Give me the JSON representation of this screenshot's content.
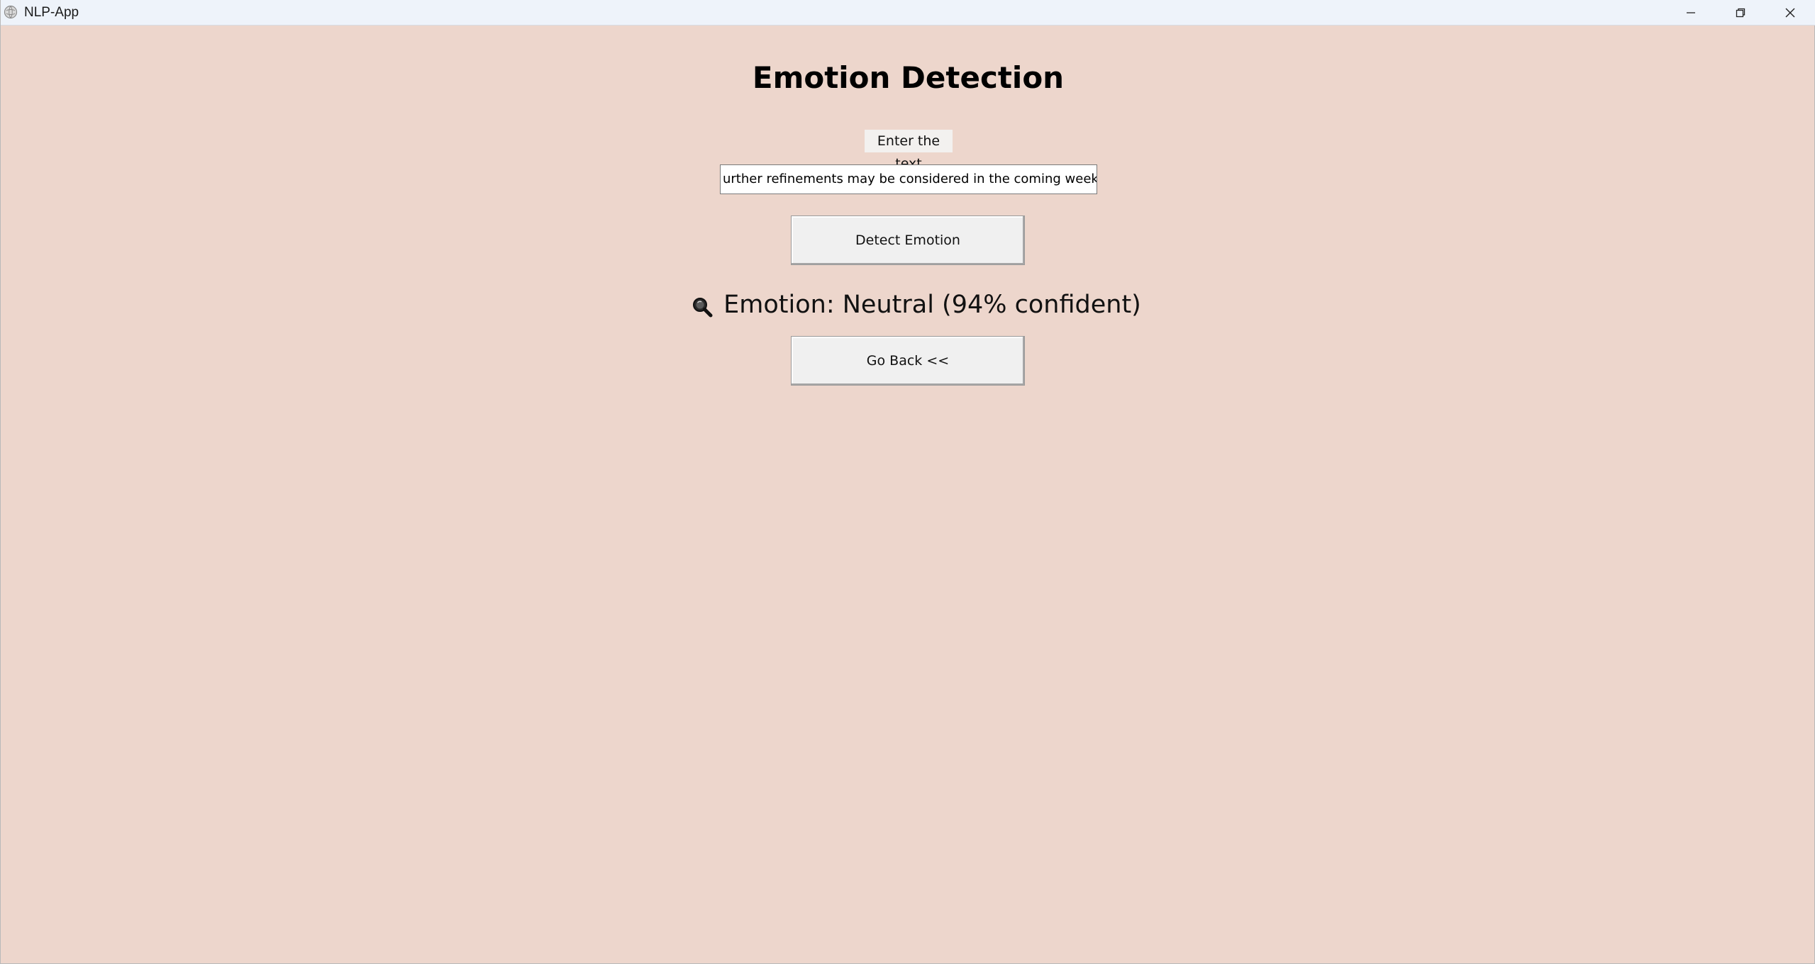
{
  "window": {
    "title": "NLP-App",
    "controls": {
      "minimize": "minimize-icon",
      "maximize": "restore-icon",
      "close": "close-icon"
    }
  },
  "page": {
    "heading": "Emotion Detection",
    "input_label": "Enter the text",
    "input_value": "urther refinements may be considered in the coming weeks.",
    "detect_button": "Detect Emotion",
    "result_icon": "magnifier-icon",
    "result_text": "Emotion: Neutral (94% confident)",
    "back_button": "Go Back <<"
  },
  "colors": {
    "background": "#EDD6CC",
    "titlebar": "#EEF3FA",
    "button": "#F0F0F0",
    "label_bg": "#F3F1EF"
  }
}
